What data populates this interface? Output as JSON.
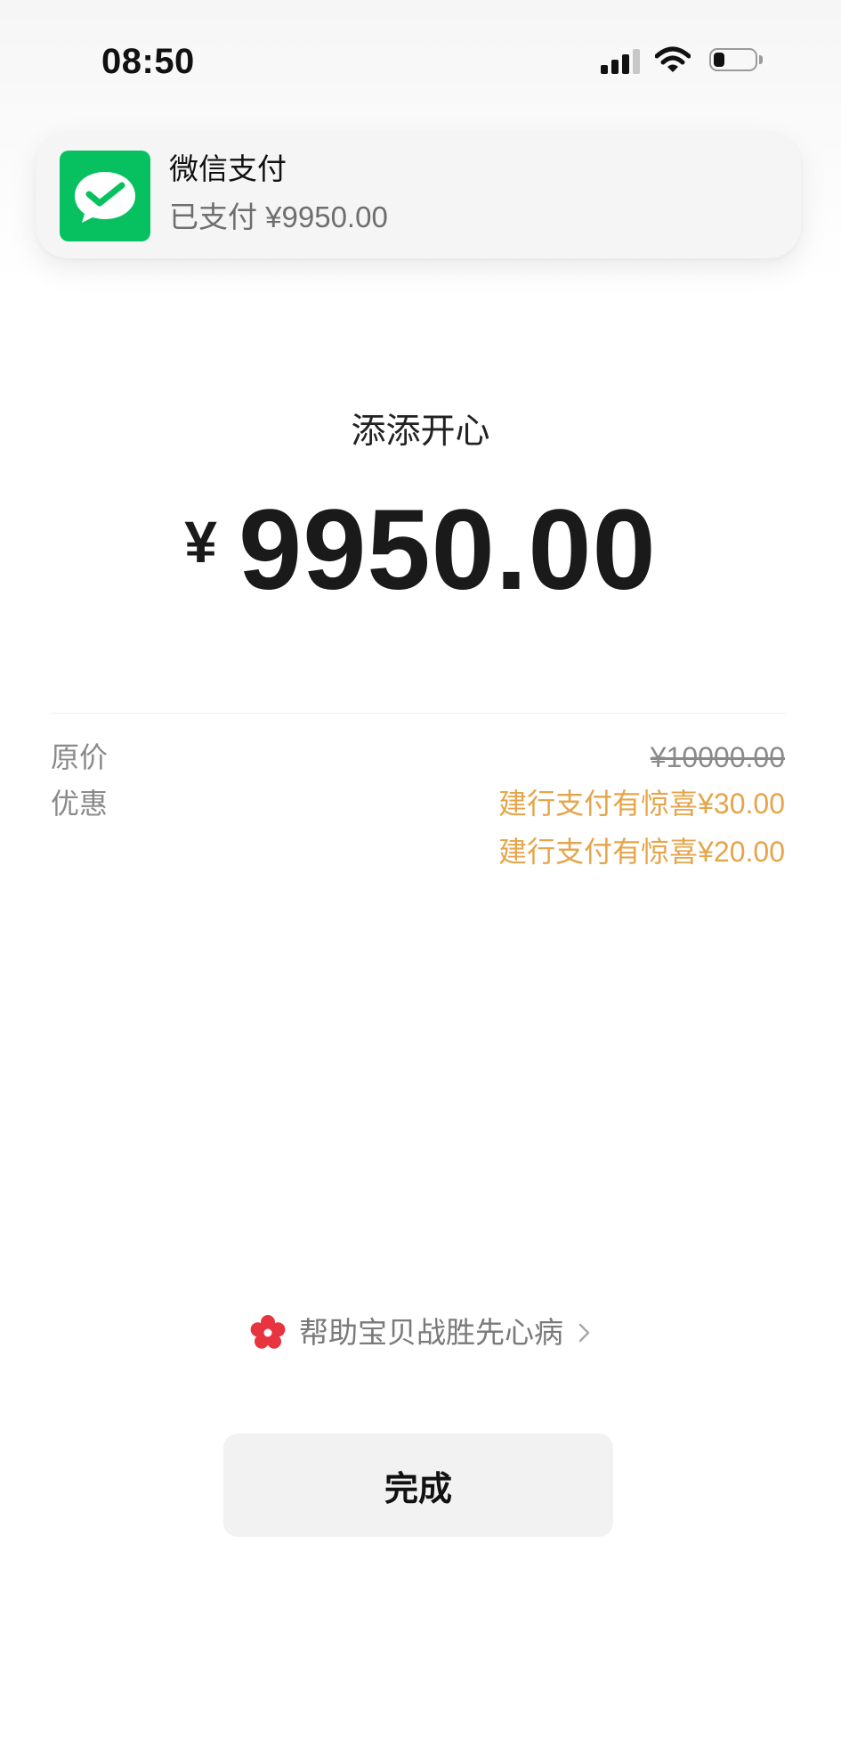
{
  "status_bar": {
    "time": "08:50",
    "signal_bars_active": 3,
    "signal_bars_total": 4,
    "battery_level": 0.28,
    "icons": [
      "cellular-signal-icon",
      "wifi-icon",
      "battery-icon"
    ]
  },
  "notification": {
    "app_icon": "wechat-pay-icon",
    "app_name": "微信支付",
    "message": "已支付 ¥9950.00",
    "accent": "#07C160"
  },
  "payment": {
    "merchant": "添添开心",
    "currency": "¥",
    "amount": "9950.00"
  },
  "details": {
    "original_price_label": "原价",
    "original_price": "¥10000.00",
    "discount_label": "优惠",
    "discounts": [
      "建行支付有惊喜¥30.00",
      "建行支付有惊喜¥20.00"
    ],
    "discount_color": "#E5A54A"
  },
  "charity": {
    "icon": "flower-icon",
    "label": "帮助宝贝战胜先心病",
    "icon_color": "#E8343F"
  },
  "done_button": {
    "label": "完成"
  }
}
